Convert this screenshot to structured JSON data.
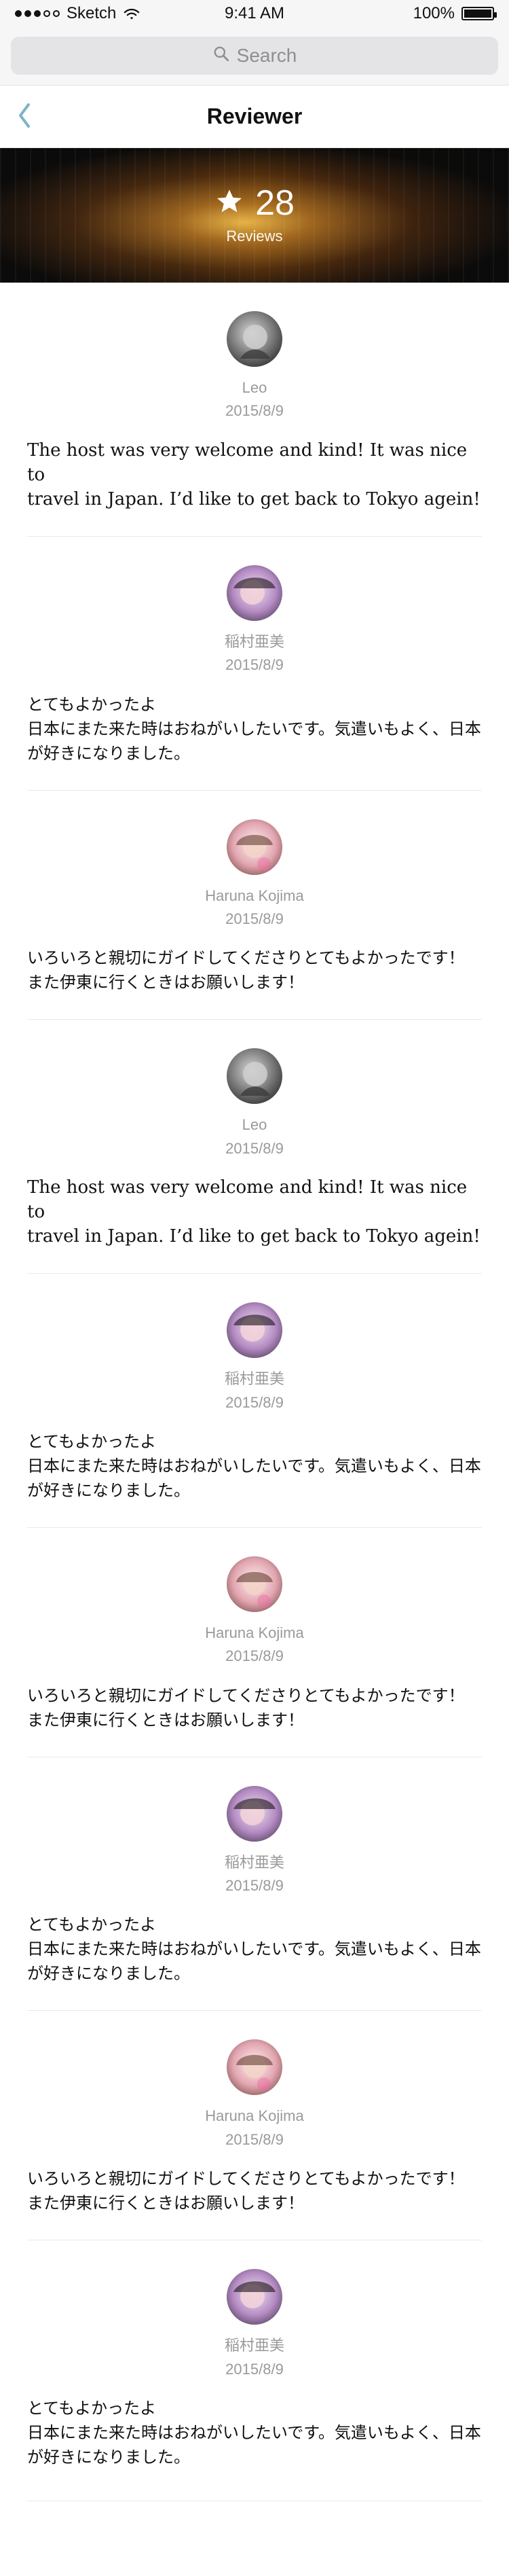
{
  "status_bar": {
    "carrier": "Sketch",
    "time": "9:41 AM",
    "battery": "100%"
  },
  "search": {
    "placeholder": "Search",
    "icon": "search-icon"
  },
  "navbar": {
    "title": "Reviewer",
    "back_icon": "chevron-left-icon"
  },
  "hero": {
    "rating": "28",
    "rating_label": "Reviews",
    "icon": "star-icon"
  },
  "reviews": [
    {
      "name": "Leo",
      "date": "2015/8/9",
      "text": "The host was very welcome and kind! It was nice to\ntravel in Japan. I’d like to get back to Tokyo agein!",
      "avatar": "avatar-leo"
    },
    {
      "name": "稲村亜美",
      "date": "2015/8/9",
      "text": "とてもよかったよ\n日本にまた来た時はおねがいしたいです。気遣いもよく、日本\nが好きになりました。",
      "avatar": "avatar-inamura"
    },
    {
      "name": "Haruna Kojima",
      "date": "2015/8/9",
      "text": "いろいろと親切にガイドしてくださりとてもよかったです！\nまた伊東に行くときはお願いします！",
      "avatar": "avatar-haruna"
    },
    {
      "name": "Leo",
      "date": "2015/8/9",
      "text": "The host was very welcome and kind! It was nice to\ntravel in Japan. I’d like to get back to Tokyo agein!",
      "avatar": "avatar-leo"
    },
    {
      "name": "稲村亜美",
      "date": "2015/8/9",
      "text": "とてもよかったよ\n日本にまた来た時はおねがいしたいです。気遣いもよく、日本\nが好きになりました。",
      "avatar": "avatar-inamura"
    },
    {
      "name": "Haruna Kojima",
      "date": "2015/8/9",
      "text": "いろいろと親切にガイドしてくださりとてもよかったです！\nまた伊東に行くときはお願いします！",
      "avatar": "avatar-haruna"
    },
    {
      "name": "稲村亜美",
      "date": "2015/8/9",
      "text": "とてもよかったよ\n日本にまた来た時はおねがいしたいです。気遣いもよく、日本\nが好きになりました。",
      "avatar": "avatar-inamura"
    },
    {
      "name": "Haruna Kojima",
      "date": "2015/8/9",
      "text": "いろいろと親切にガイドしてくださりとてもよかったです！\nまた伊東に行くときはお願いします！",
      "avatar": "avatar-haruna"
    },
    {
      "name": "稲村亜美",
      "date": "2015/8/9",
      "text": "とてもよかったよ\n日本にまた来た時はおねがいしたいです。気遣いもよく、日本\nが好きになりました。",
      "avatar": "avatar-inamura"
    }
  ],
  "colors": {
    "accent": "#7fb3c8",
    "muted_text": "#9a9a9a",
    "separator": "#e9e9e9"
  }
}
